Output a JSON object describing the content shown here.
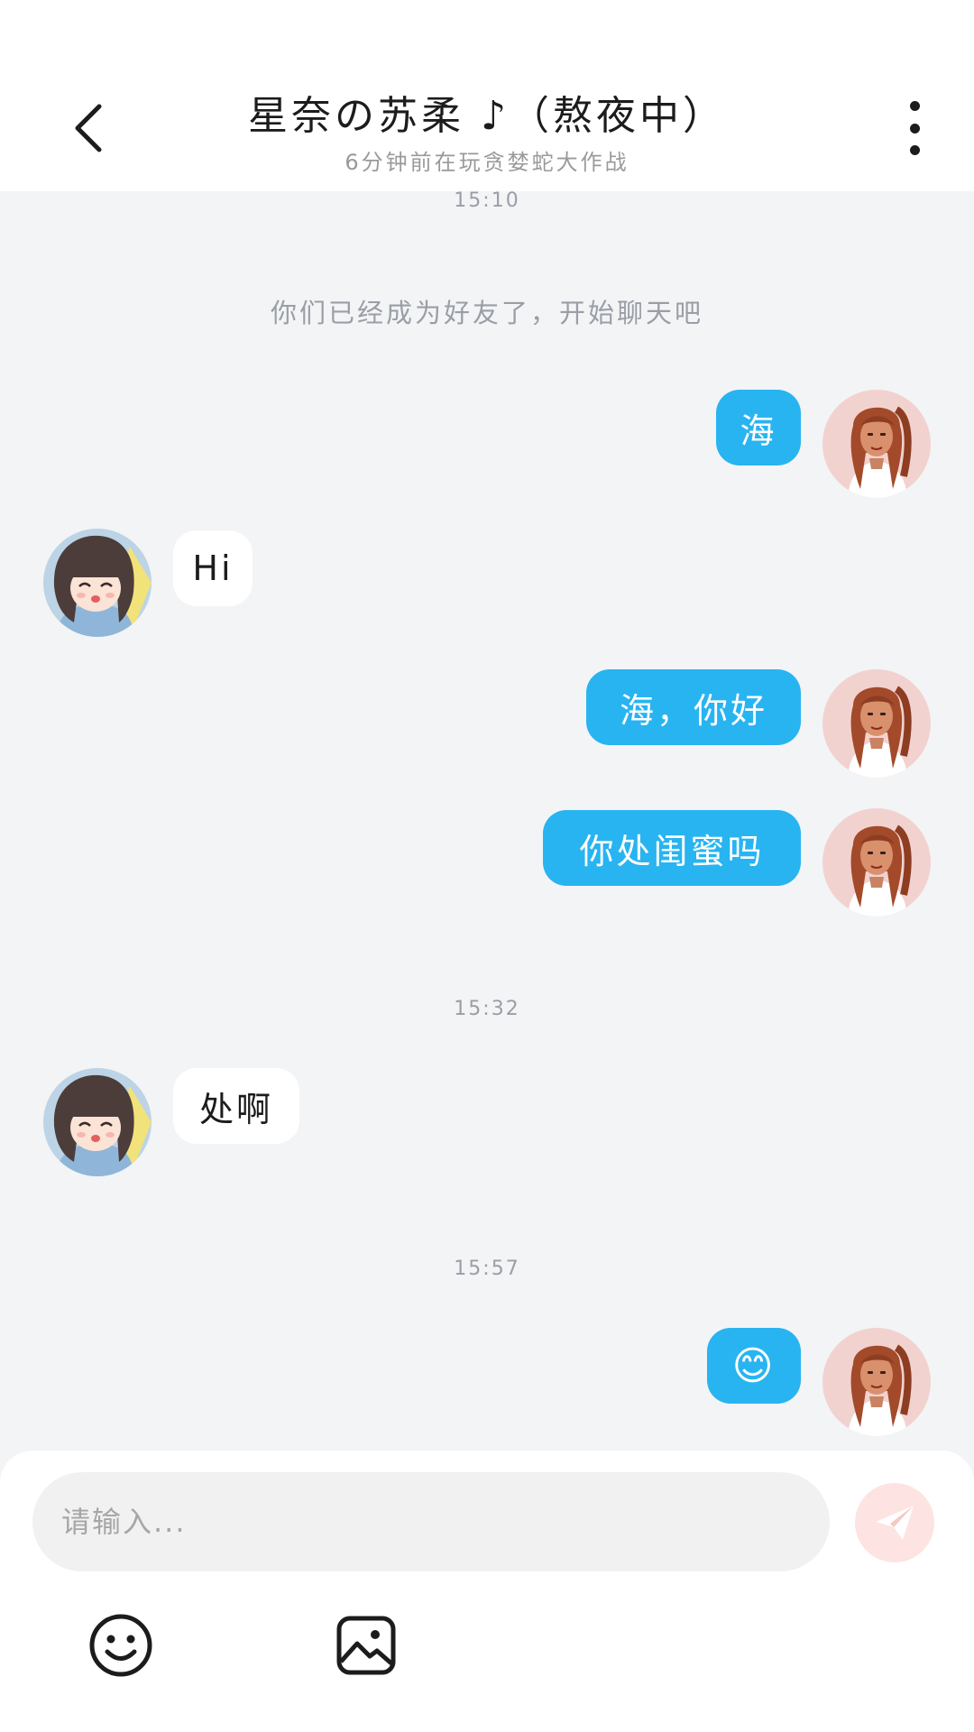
{
  "header": {
    "title": "星奈の苏柔 ♪（熬夜中）",
    "subtitle": "6分钟前在玩贪婪蛇大作战"
  },
  "chat": {
    "time_1": "15:10",
    "system_note": "你们已经成为好友了，开始聊天吧",
    "msg_1": "海",
    "msg_2": "Hi",
    "msg_3": "海，你好",
    "msg_4": "你处闺蜜吗",
    "time_2": "15:32",
    "msg_5": "处啊",
    "time_3": "15:57",
    "msg_6": "😊"
  },
  "input": {
    "placeholder": "请输入..."
  },
  "colors": {
    "my_bubble": "#28b4f1",
    "their_bubble": "#ffffff",
    "background": "#f3f4f6",
    "send_button": "#fde3e1"
  },
  "icons": [
    "back-arrow-icon",
    "more-vertical-icon",
    "send-icon",
    "smiley-icon",
    "image-icon"
  ]
}
